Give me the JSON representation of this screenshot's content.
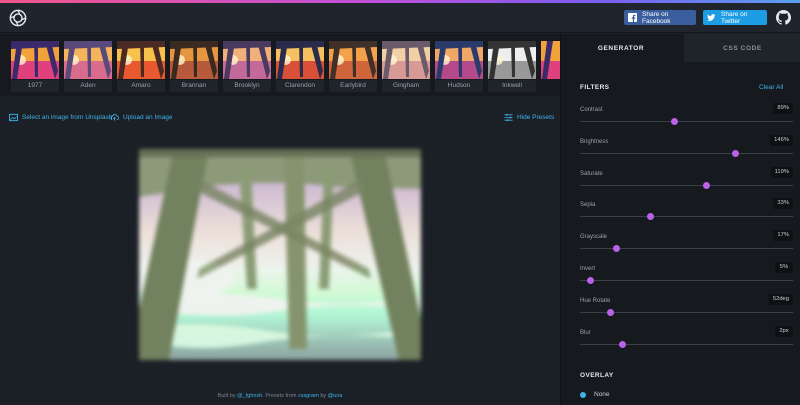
{
  "header": {
    "share_facebook": "Share on Facebook",
    "share_twitter": "Share on Twitter"
  },
  "presets": [
    "1977",
    "Aden",
    "Amaro",
    "Brannan",
    "Brooklyn",
    "Clarendon",
    "Earlybird",
    "Gingham",
    "Hudson",
    "Inkwell"
  ],
  "actions": {
    "unsplash": "Select an image from Unsplash",
    "upload": "Upload an Image",
    "hide": "Hide Presets"
  },
  "credit": {
    "prefix": "Built by",
    "author": "@_fghosh",
    "mid": ". Presets from",
    "source": "cssgram",
    "by": "by",
    "source_author": "@una"
  },
  "panel": {
    "tab_generator": "GENERATOR",
    "tab_css": "CSS CODE",
    "filters_title": "FILTERS",
    "clear_all": "Clear All",
    "overlay_title": "OVERLAY",
    "overlay_option": "None"
  },
  "filters": [
    {
      "label": "Contrast",
      "value": "89%",
      "level": 0.445
    },
    {
      "label": "Brightness",
      "value": "146%",
      "level": 0.73
    },
    {
      "label": "Saturate",
      "value": "119%",
      "level": 0.595
    },
    {
      "label": "Sepia",
      "value": "33%",
      "level": 0.33
    },
    {
      "label": "Grayscale",
      "value": "17%",
      "level": 0.17
    },
    {
      "label": "Invert",
      "value": "5%",
      "level": 0.05
    },
    {
      "label": "Hue Rotate",
      "value": "52deg",
      "level": 0.144
    },
    {
      "label": "Blur",
      "value": "2px",
      "level": 0.2
    }
  ],
  "colors": {
    "accent": "#3fb4ea",
    "knob": "#b962e8",
    "facebook": "#3a5e9d",
    "twitter": "#1c9de4"
  }
}
